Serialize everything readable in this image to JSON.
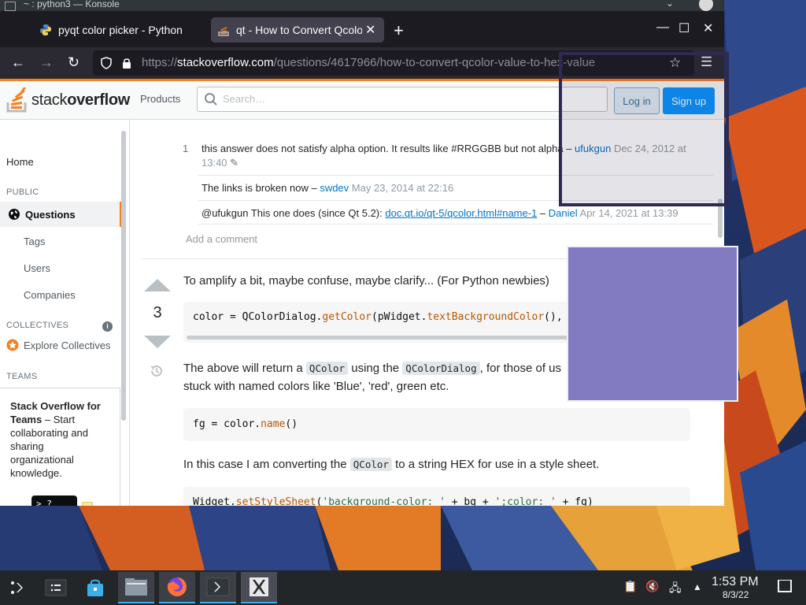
{
  "konsole": {
    "title": "~ : python3 — Konsole"
  },
  "browser": {
    "tabs": [
      {
        "label": "pyqt color picker - Python Tutorial",
        "active": false
      },
      {
        "label": "qt - How to Convert Qcolor Value to Hex",
        "active": true
      }
    ],
    "new_tab": "+",
    "window_controls": {
      "minimize": "—",
      "maximize": "☐",
      "close": "✕"
    },
    "url_prefix": "https://",
    "url_host": "stackoverflow.com",
    "url_path": "/questions/4617966/how-to-convert-qcolor-value-to-hex-value"
  },
  "so": {
    "logo_light": "stack",
    "logo_bold": "overflow",
    "products": "Products",
    "search_placeholder": "Search…",
    "login": "Log in",
    "signup": "Sign up"
  },
  "sidebar": {
    "home": "Home",
    "public": "PUBLIC",
    "questions": "Questions",
    "tags": "Tags",
    "users": "Users",
    "companies": "Companies",
    "collectives": "COLLECTIVES",
    "explore": "Explore Collectives",
    "teams": "TEAMS",
    "teams_title": "Stack Overflow for Teams",
    "teams_desc": " – Start collaborating and sharing organizational knowledge.",
    "teams_prompt": ">_?"
  },
  "comments": [
    {
      "score": "1",
      "text": "this answer does not satisfy alpha option. It results like #RRGGBB but not alpha",
      "sep": " – ",
      "user": "ufukgun",
      "date": "Dec 24, 2012 at 13:40"
    },
    {
      "score": "",
      "text": "The links is broken now",
      "sep": " – ",
      "user": "swdev",
      "date": "May 23, 2014 at 22:16"
    },
    {
      "score": "",
      "text": "@ufukgun This one does (since Qt 5.2): ",
      "link": "doc.qt.io/qt-5/qcolor.html#name-1",
      "sep": " – ",
      "user": "Daniel",
      "date": "Apr 14, 2021 at 13:39"
    }
  ],
  "add_comment": "Add a comment",
  "answer": {
    "votes": "3",
    "intro": "To amplify a bit, maybe confuse, maybe clarify... (For Python newbies)",
    "code1": {
      "a": "color = QColorDialog.",
      "b": "getColor",
      "c": "(pWidget.",
      "d": "textBackgroundColor",
      "e": "(),"
    },
    "p2_a": "The above will return a ",
    "p2_code1": "QColor",
    "p2_b": " using the ",
    "p2_code2": "QColorDialog",
    "p2_c": ", for those of us",
    "p2_d": "stuck with named colors like 'Blue', 'red', green etc.",
    "code2": {
      "a": "fg = color.",
      "b": "name",
      "c": "()"
    },
    "p3_a": "In this case I am converting the ",
    "p3_code": "QColor",
    "p3_b": " to a string HEX for use in a style sheet.",
    "code3": {
      "a": "Widget.",
      "b": "setStyleSheet",
      "c": "(",
      "d": "'background-color: '",
      "e": " + bg + ",
      "f": "';color: '",
      "g": " + fg)"
    }
  },
  "picker": {
    "swatch_color": "#827bc2"
  },
  "taskbar": {
    "time": "1:53 PM",
    "date": "8/3/22"
  }
}
